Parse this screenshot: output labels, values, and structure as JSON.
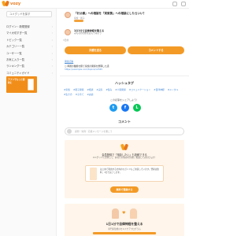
{
  "header": {
    "logo_text": "vozy"
  },
  "sidebar": {
    "top_button": "ユメグッドを探す",
    "items": [
      {
        "label": "ログイン・新規登録"
      },
      {
        "label": "マイ大切すぎ一覧"
      },
      {
        "label": "トピック一覧"
      },
      {
        "label": "カテゴリー一覧"
      },
      {
        "label": "ユーザー一覧"
      },
      {
        "label": "お気に入り一覧"
      },
      {
        "label": "ランキング一覧"
      },
      {
        "label": "コミュニティガイド"
      },
      {
        "label": "ヘルプ・お問い合わせ"
      }
    ],
    "banner_text": "アプリでもっと便利に"
  },
  "question": {
    "title": "「お父様」への相談を「実家族」への相談にしたらいい？",
    "meta": "家族・親子"
  },
  "answer": {
    "name": "1日1分で自律神経を整える",
    "sub": "みんなの回答を読んでみよう",
    "time": "3日前"
  },
  "buttons": {
    "left": "共感を送る",
    "right": "コメントする"
  },
  "related": {
    "label": "関連記事",
    "lines": [
      "○ 両親の離婚を経て家族の関係を整理した話",
      "https://example.com/topics/12345"
    ]
  },
  "hashtags": {
    "title": "ハッシュタグ",
    "tags": [
      "#家族",
      "#親子関係",
      "#相談",
      "#実家",
      "#悩み",
      "#人間関係",
      "#コミュニケーション",
      "#自律神経",
      "#メンタル",
      "#生き方",
      "#子育て",
      "#夫婦"
    ]
  },
  "share": {
    "label": "この記事をシェアしよう！",
    "twitter": "t",
    "facebook": "f",
    "line": "L"
  },
  "comments": {
    "title": "コメント",
    "placeholder": "感想・質問・応援メッセージを書こう"
  },
  "register": {
    "title": "会員登録で「相談したい」も投稿できる",
    "sub": "ユメグッドに登録して、あなたの悩みを気軽に\n相談してみませんか？",
    "card_text": "はじめて利用する方向けのガイドもご用意しています。登録は無料、1分で完了します。",
    "button": "無料で登録する"
  },
  "promo": {
    "title": "1日1分で自律神経を整える",
    "sub": "専門家監修のセルフケアプログラム"
  }
}
